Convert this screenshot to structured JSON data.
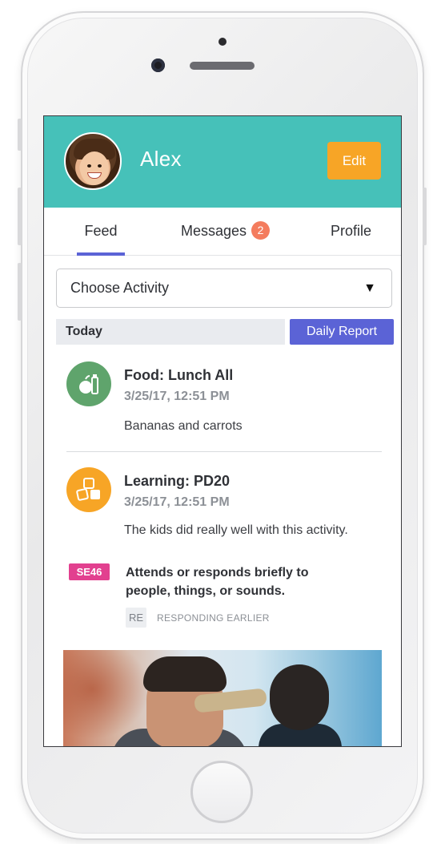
{
  "header": {
    "child_name": "Alex",
    "edit_label": "Edit",
    "accent_color": "#46c1b9"
  },
  "tabs": [
    {
      "label": "Feed",
      "active": true
    },
    {
      "label": "Messages",
      "badge": "2"
    },
    {
      "label": "Profile"
    }
  ],
  "filter": {
    "selected": "Choose Activity",
    "arrow": "▼"
  },
  "day_section": {
    "label": "Today",
    "report_button": "Daily Report"
  },
  "entries": [
    {
      "icon": "food-apple-icon",
      "title": "Food: Lunch All",
      "time": "3/25/17, 12:51 PM",
      "note": "Bananas and carrots"
    },
    {
      "icon": "learning-blocks-icon",
      "title": "Learning: PD20",
      "time": "3/25/17, 12:51 PM",
      "note": "The kids did really well with this activity.",
      "measure": {
        "code": "SE46",
        "text": "Attends or responds briefly to people, things, or sounds.",
        "level_code": "RE",
        "level_label": "RESPONDING EARLIER"
      }
    }
  ],
  "colors": {
    "primary": "#5b63d6",
    "food": "#5fa46c",
    "learning": "#f7a526",
    "badge": "#f47c5e",
    "measure_tag": "#e2408f"
  }
}
